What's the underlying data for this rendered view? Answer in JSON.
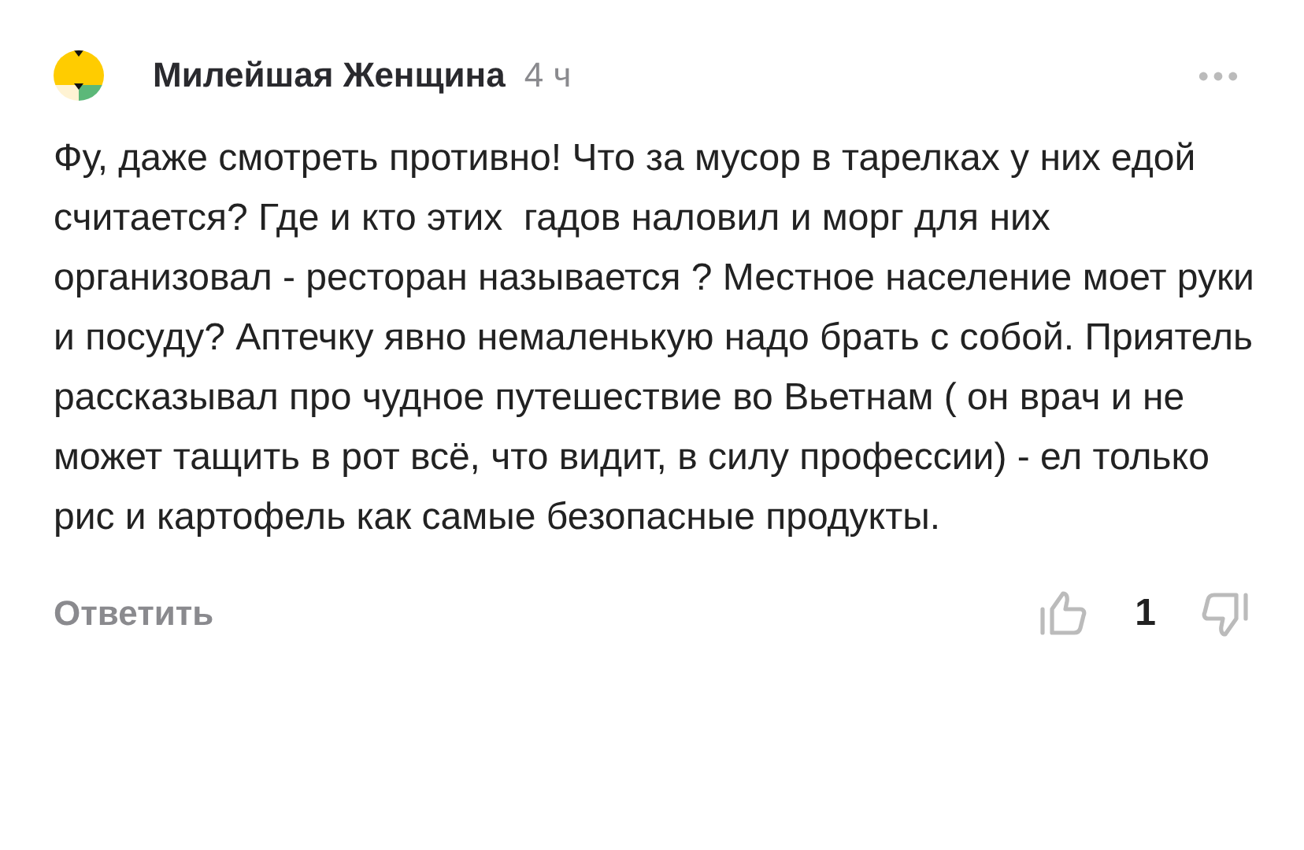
{
  "comment": {
    "author": "Милейшая Женщина",
    "time": "4 ч",
    "text": "Фу, даже смотреть противно! Что за мусор в тарелках у них едой считается? Где и кто этих  гадов наловил и морг для них организовал - ресторан называется ? Местное население моет руки и посуду? Аптечку явно немаленькую надо брать с собой. Приятель рассказывал про чудное путешествие во Вьетнам ( он врач и не может тащить в рот всё, что видит, в силу профессии) - ел только рис и картофель как самые безопасные продукты.",
    "reply_label": "Ответить",
    "likes": "1"
  }
}
